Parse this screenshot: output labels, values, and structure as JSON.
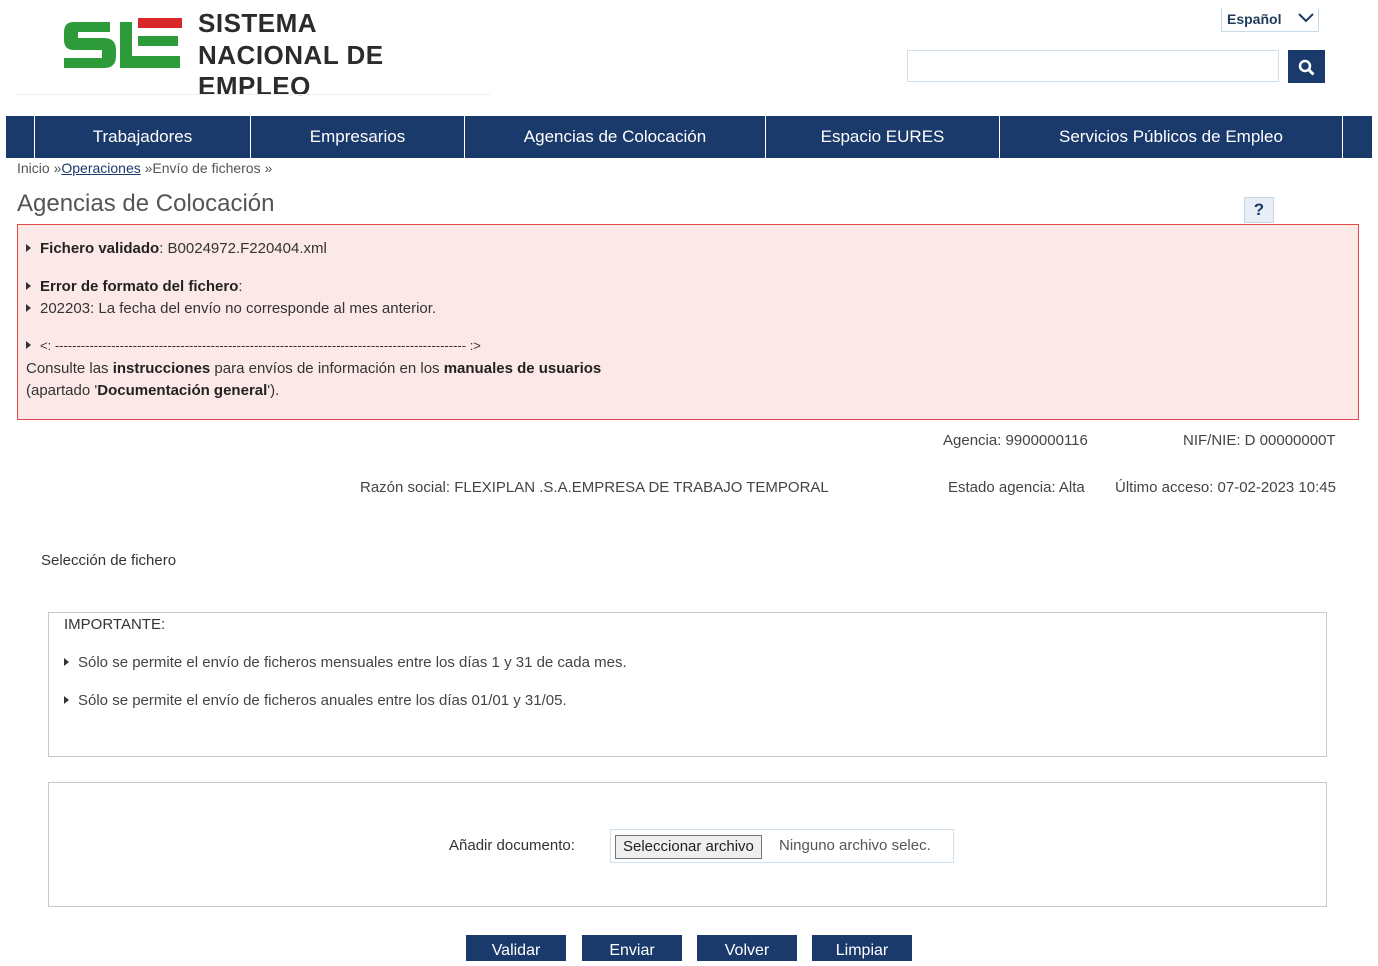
{
  "header": {
    "logo_line1": "SISTEMA",
    "logo_line2": "NACIONAL DE EMPLEO",
    "language": "Español",
    "search_value": "",
    "brand_green": "#2d9b3a",
    "brand_red": "#d62828",
    "nav_color": "#1a3a6c"
  },
  "nav": {
    "items": [
      "Trabajadores",
      "Empresarios",
      "Agencias de Colocación",
      "Espacio EURES",
      "Servicios Públicos de Empleo"
    ]
  },
  "breadcrumb": {
    "home": "Inicio »",
    "operations": "Operaciones",
    "current": " »Envío de ficheros »"
  },
  "page": {
    "title": "Agencias de Colocación",
    "help": "?"
  },
  "error": {
    "validated_label": "Fichero validado",
    "validated_value": ": B0024972.F220404.xml",
    "format_error_label": "Error de formato del fichero",
    "format_error_suffix": ":",
    "error_detail": "202203: La fecha del envío no corresponde al mes anterior.",
    "separator": "<: ----------------------------------------------------------------------------------------------- :>",
    "consult_1": "Consulte las ",
    "consult_2": "instrucciones",
    "consult_3": " para envíos de información en los ",
    "consult_4": "manuales de usuarios",
    "consult_5": "(apartado '",
    "consult_6": "Documentación general",
    "consult_7": "')."
  },
  "agency": {
    "agencia": "Agencia: 9900000116",
    "nif": "NIF/NIE: D 00000000T",
    "razon": "Razón social: FLEXIPLAN .S.A.EMPRESA DE TRABAJO TEMPORAL",
    "estado": "Estado agencia: Alta",
    "ultimo": "Último acceso: 07-02-2023 10:45"
  },
  "selection": {
    "label": "Selección de fichero",
    "important_title": "IMPORTANTE:",
    "rule1": "Sólo se permite el envío de ficheros mensuales entre los días 1 y 31 de cada mes.",
    "rule2": "Sólo se permite el envío de ficheros anuales entre los días 01/01 y 31/05."
  },
  "upload": {
    "label": "Añadir documento:",
    "button": "Seleccionar archivo",
    "status": "Ninguno archivo selec."
  },
  "actions": {
    "validar": "Validar",
    "enviar": "Enviar",
    "volver": "Volver",
    "limpiar": "Limpiar"
  }
}
